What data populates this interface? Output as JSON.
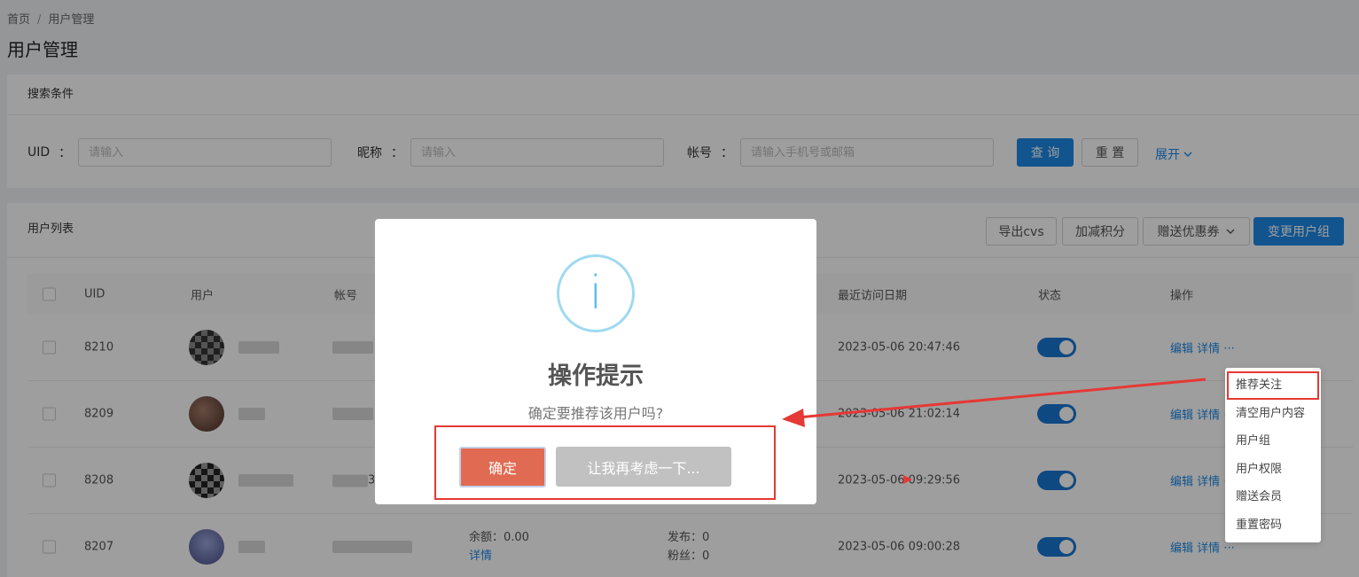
{
  "breadcrumb": {
    "home": "首页",
    "separator": "/",
    "current": "用户管理"
  },
  "page_title": "用户管理",
  "search": {
    "title": "搜索条件",
    "uid_label": "UID",
    "uid_placeholder": "请输入",
    "nickname_label": "昵称",
    "nickname_placeholder": "请输入",
    "account_label": "帐号",
    "account_placeholder": "请输入手机号或邮箱",
    "colon": "：",
    "query_button": "查 询",
    "reset_button": "重 置",
    "expand_link": "展开",
    "expand_icon": "chevron-down-icon"
  },
  "list": {
    "title": "用户列表",
    "toolbar": {
      "export": "导出cvs",
      "points": "加减积分",
      "coupon": "赠送优惠券",
      "change_group": "变更用户组"
    },
    "columns": {
      "uid": "UID",
      "user": "用户",
      "account": "帐号",
      "last_visit": "最近访问日期",
      "status": "状态",
      "ops": "操作"
    },
    "rows": [
      {
        "uid": "8210",
        "last_visit": "2023-05-06 20:47:46",
        "edit": "编辑",
        "detail": "详情",
        "more": "···"
      },
      {
        "uid": "8209",
        "last_visit": "2023-05-06 21:02:14",
        "edit": "编辑",
        "detail": "详情",
        "more": "···"
      },
      {
        "uid": "8208",
        "account_fragment": "3",
        "last_visit": "2023-05-06 09:29:56",
        "edit": "编辑",
        "detail": "详情",
        "more": "···"
      },
      {
        "uid": "8207",
        "balance": "余额：0.00",
        "balance_detail": "详情",
        "posts": "发布：0",
        "fans": "粉丝：0",
        "last_visit": "2023-05-06 09:00:28",
        "edit": "编辑",
        "detail": "详情",
        "more": "···"
      }
    ]
  },
  "dropdown": {
    "items": [
      "推荐关注",
      "清空用户内容",
      "用户组",
      "用户权限",
      "赠送会员",
      "重置密码"
    ]
  },
  "modal": {
    "icon": "info-icon",
    "icon_glyph": "i",
    "title": "操作提示",
    "message": "确定要推荐该用户吗?",
    "confirm": "确定",
    "cancel": "让我再考虑一下..."
  },
  "colors": {
    "primary": "#1e88e5",
    "confirm": "#e06b52",
    "annotation": "#e53935",
    "toggle_on": "#1976d2"
  }
}
